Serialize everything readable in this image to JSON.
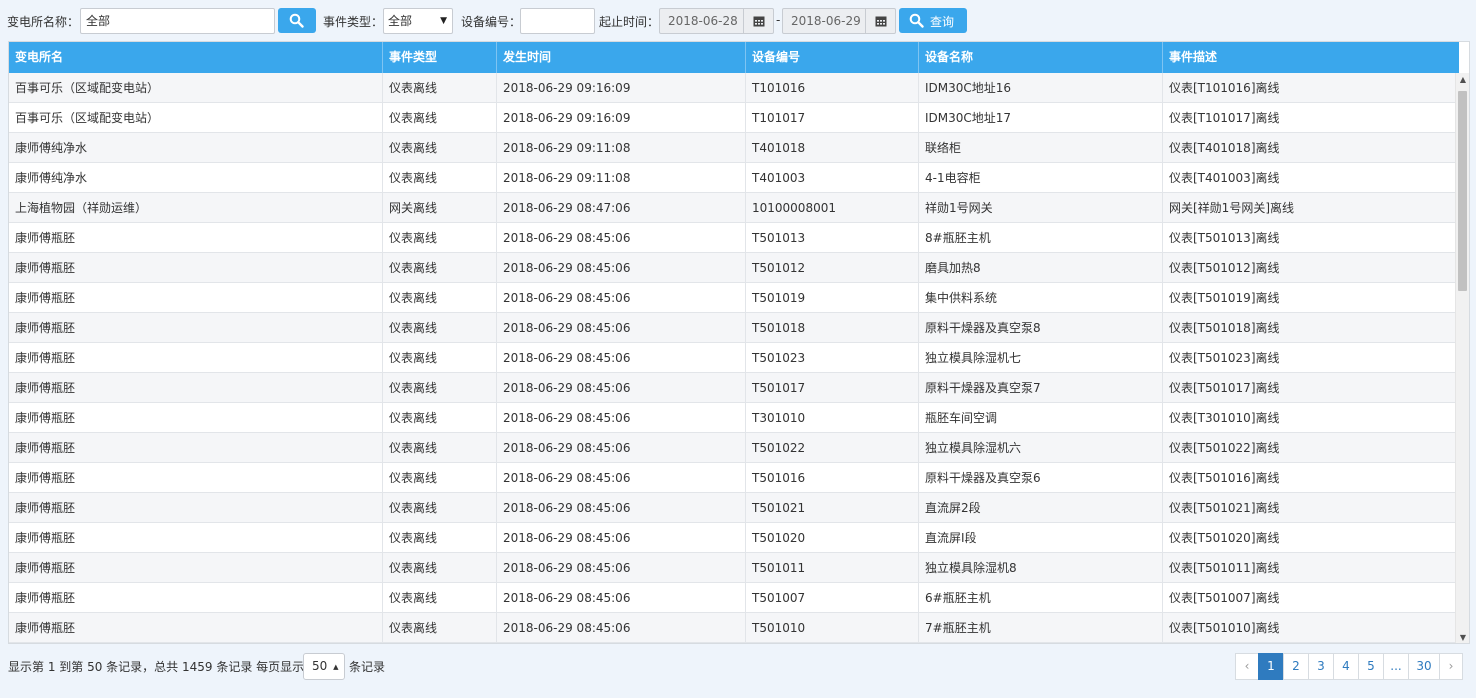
{
  "toolbar": {
    "station_label": "变电所名称：",
    "station_value": "全部",
    "event_type_label": "事件类型：",
    "event_type_value": "全部",
    "device_no_label": "设备编号：",
    "device_no_value": "",
    "time_label": "起止时间：",
    "start_date": "2018-06-28",
    "date_separator": "-",
    "end_date": "2018-06-29",
    "query_label": "查询"
  },
  "table": {
    "columns": [
      "变电所名",
      "事件类型",
      "发生时间",
      "设备编号",
      "设备名称",
      "事件描述"
    ],
    "rows": [
      [
        "百事可乐（区域配变电站）",
        "仪表离线",
        "2018-06-29 09:16:09",
        "T101016",
        "IDM30C地址16",
        "仪表[T101016]离线"
      ],
      [
        "百事可乐（区域配变电站）",
        "仪表离线",
        "2018-06-29 09:16:09",
        "T101017",
        "IDM30C地址17",
        "仪表[T101017]离线"
      ],
      [
        "康师傅纯净水",
        "仪表离线",
        "2018-06-29 09:11:08",
        "T401018",
        "联络柜",
        "仪表[T401018]离线"
      ],
      [
        "康师傅纯净水",
        "仪表离线",
        "2018-06-29 09:11:08",
        "T401003",
        "4-1电容柜",
        "仪表[T401003]离线"
      ],
      [
        "上海植物园（祥勋运维）",
        "网关离线",
        "2018-06-29 08:47:06",
        "10100008001",
        "祥勋1号网关",
        "网关[祥勋1号网关]离线"
      ],
      [
        "康师傅瓶胚",
        "仪表离线",
        "2018-06-29 08:45:06",
        "T501013",
        "8#瓶胚主机",
        "仪表[T501013]离线"
      ],
      [
        "康师傅瓶胚",
        "仪表离线",
        "2018-06-29 08:45:06",
        "T501012",
        "磨具加热8",
        "仪表[T501012]离线"
      ],
      [
        "康师傅瓶胚",
        "仪表离线",
        "2018-06-29 08:45:06",
        "T501019",
        "集中供料系统",
        "仪表[T501019]离线"
      ],
      [
        "康师傅瓶胚",
        "仪表离线",
        "2018-06-29 08:45:06",
        "T501018",
        "原料干燥器及真空泵8",
        "仪表[T501018]离线"
      ],
      [
        "康师傅瓶胚",
        "仪表离线",
        "2018-06-29 08:45:06",
        "T501023",
        "独立模具除湿机七",
        "仪表[T501023]离线"
      ],
      [
        "康师傅瓶胚",
        "仪表离线",
        "2018-06-29 08:45:06",
        "T501017",
        "原料干燥器及真空泵7",
        "仪表[T501017]离线"
      ],
      [
        "康师傅瓶胚",
        "仪表离线",
        "2018-06-29 08:45:06",
        "T301010",
        "瓶胚车间空调",
        "仪表[T301010]离线"
      ],
      [
        "康师傅瓶胚",
        "仪表离线",
        "2018-06-29 08:45:06",
        "T501022",
        "独立模具除湿机六",
        "仪表[T501022]离线"
      ],
      [
        "康师傅瓶胚",
        "仪表离线",
        "2018-06-29 08:45:06",
        "T501016",
        "原料干燥器及真空泵6",
        "仪表[T501016]离线"
      ],
      [
        "康师傅瓶胚",
        "仪表离线",
        "2018-06-29 08:45:06",
        "T501021",
        "直流屏2段",
        "仪表[T501021]离线"
      ],
      [
        "康师傅瓶胚",
        "仪表离线",
        "2018-06-29 08:45:06",
        "T501020",
        "直流屏Ⅰ段",
        "仪表[T501020]离线"
      ],
      [
        "康师傅瓶胚",
        "仪表离线",
        "2018-06-29 08:45:06",
        "T501011",
        "独立模具除湿机8",
        "仪表[T501011]离线"
      ],
      [
        "康师傅瓶胚",
        "仪表离线",
        "2018-06-29 08:45:06",
        "T501007",
        "6#瓶胚主机",
        "仪表[T501007]离线"
      ],
      [
        "康师傅瓶胚",
        "仪表离线",
        "2018-06-29 08:45:06",
        "T501010",
        "7#瓶胚主机",
        "仪表[T501010]离线"
      ]
    ]
  },
  "footer": {
    "summary_text": "显示第 1 到第 50 条记录，总共 1459 条记录 每页显示",
    "page_size": "50",
    "page_size_suffix": "条记录"
  },
  "pagination": {
    "prev": "‹",
    "pages": [
      "1",
      "2",
      "3",
      "4",
      "5",
      "...",
      "30"
    ],
    "next": "›",
    "active_page": "1"
  },
  "colors": {
    "accent": "#3aa7ec",
    "active_page": "#2f7bbf"
  },
  "icons": {
    "search": "search-icon",
    "calendar": "calendar-icon"
  }
}
